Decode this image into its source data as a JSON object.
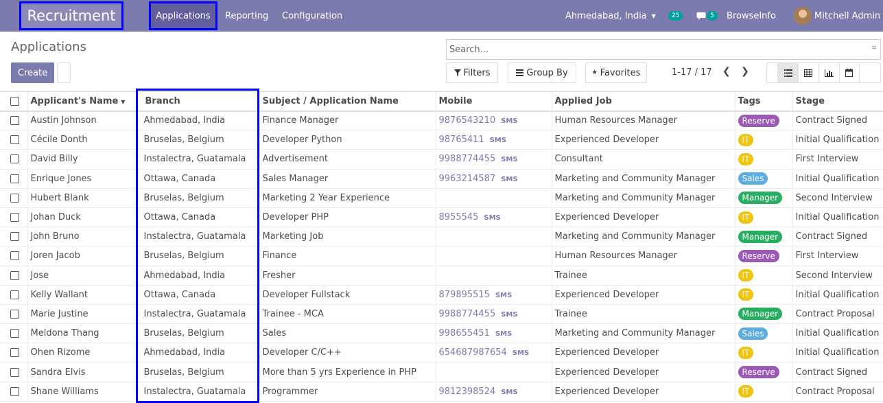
{
  "navbar": {
    "brand": "Recruitment",
    "menu": [
      "Applications",
      "Reporting",
      "Configuration"
    ],
    "location": "Ahmedabad, India",
    "activity_count": "25",
    "message_count": "5",
    "browse_info": "BrowseInfo",
    "user": "Mitchell Admin"
  },
  "control": {
    "title": "Applications",
    "create_label": "Create",
    "search_placeholder": "Search...",
    "filters_label": "Filters",
    "group_by_label": "Group By",
    "favorites_label": "Favorites",
    "pager": "1-17 / 17"
  },
  "table": {
    "headers": [
      "Applicant's Name",
      "Branch",
      "Subject / Application Name",
      "Mobile",
      "Applied Job",
      "Tags",
      "Stage"
    ],
    "sms_label": "SMS",
    "rows": [
      [
        "Austin Johnson",
        "Ahmedabad, India",
        "Finance Manager",
        "9876543210",
        "Human Resources Manager",
        "Reserve",
        "Contract Signed"
      ],
      [
        "Cécile Donth",
        "Bruselas, Belgium",
        "Developer Python",
        "98765411",
        "Experienced Developer",
        "IT",
        "Initial Qualification"
      ],
      [
        "David Billy",
        "Instalectra, Guatamala",
        "Advertisement",
        "9988774455",
        "Consultant",
        "IT",
        "First Interview"
      ],
      [
        "Enrique Jones",
        "Ottawa, Canada",
        "Sales Manager",
        "9963214587",
        "Marketing and Community Manager",
        "Sales",
        "Initial Qualification"
      ],
      [
        "Hubert Blank",
        "Bruselas, Belgium",
        "Marketing 2 Year Experience",
        "",
        "Marketing and Community Manager",
        "Manager",
        "Second Interview"
      ],
      [
        "Johan Duck",
        "Ottawa, Canada",
        "Developer PHP",
        "8955545",
        "Experienced Developer",
        "IT",
        "Initial Qualification"
      ],
      [
        "John Bruno",
        "Instalectra, Guatamala",
        "Marketing Job",
        "",
        "Marketing and Community Manager",
        "Manager",
        "Contract Signed"
      ],
      [
        "Joren Jacob",
        "Bruselas, Belgium",
        "Finance",
        "",
        "Human Resources Manager",
        "Reserve",
        "First Interview"
      ],
      [
        "Jose",
        "Ahmedabad, India",
        "Fresher",
        "",
        "Trainee",
        "IT",
        "Second Interview"
      ],
      [
        "Kelly Wallant",
        "Ottawa, Canada",
        "Developer Fullstack",
        "879895515",
        "Experienced Developer",
        "IT",
        "Initial Qualification"
      ],
      [
        "Marie Justine",
        "Instalectra, Guatamala",
        "Trainee - MCA",
        "9988774455",
        "Trainee",
        "Manager",
        "Contract Proposal"
      ],
      [
        "Meldona Thang",
        "Bruselas, Belgium",
        "Sales",
        "998655451",
        "Marketing and Community Manager",
        "Sales",
        "Initial Qualification"
      ],
      [
        "Ohen Rizome",
        "Ahmedabad, India",
        "Developer C/C++",
        "654687987654",
        "Experienced Developer",
        "IT",
        "Initial Qualification"
      ],
      [
        "Sandra Elvis",
        "Bruselas, Belgium",
        "More than 5 yrs Experience in PHP",
        "",
        "Experienced Developer",
        "Reserve",
        "Contract Signed"
      ],
      [
        "Shane Williams",
        "Instalectra, Guatamala",
        "Programmer",
        "9812398524",
        "Experienced Developer",
        "IT",
        "Contract Proposal"
      ]
    ]
  },
  "tag_colors": {
    "Reserve": "#9b59b6",
    "IT": "#f1c40f",
    "Sales": "#5dade2",
    "Manager": "#27ae60"
  },
  "colors": {
    "navbar": "#7c7bad",
    "highlight_box": "#0000ff",
    "badge": "#00a09d"
  }
}
